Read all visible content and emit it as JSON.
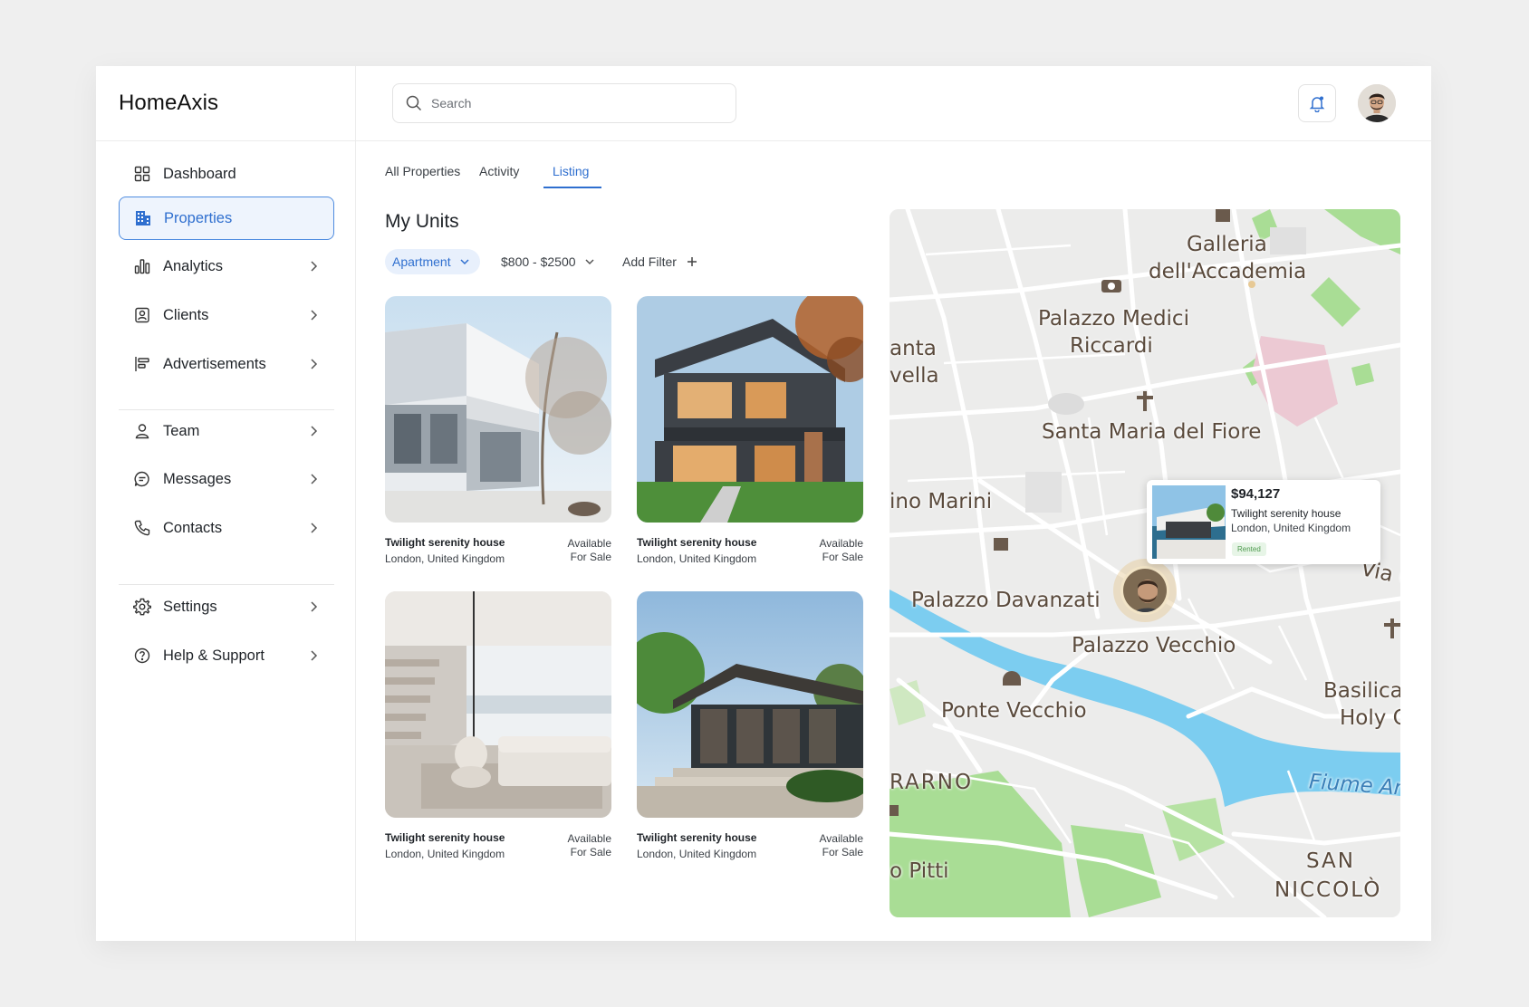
{
  "brand": "HomeAxis",
  "search": {
    "placeholder": "Search"
  },
  "sidebar": {
    "items": [
      {
        "label": "Dashboard",
        "icon": "grid-icon"
      },
      {
        "label": "Properties",
        "icon": "building-icon",
        "active": true
      },
      {
        "label": "Analytics",
        "icon": "bar-chart-icon"
      },
      {
        "label": "Clients",
        "icon": "contact-card-icon"
      },
      {
        "label": "Advertisements",
        "icon": "ads-icon"
      },
      {
        "label": "Team",
        "icon": "user-icon"
      },
      {
        "label": "Messages",
        "icon": "chat-icon"
      },
      {
        "label": "Contacts",
        "icon": "phone-icon"
      },
      {
        "label": "Settings",
        "icon": "gear-icon"
      },
      {
        "label": "Help & Support",
        "icon": "help-icon"
      }
    ]
  },
  "tabs": [
    {
      "label": "All Properties"
    },
    {
      "label": "Activity"
    },
    {
      "label": "Listing",
      "active": true
    }
  ],
  "main": {
    "title": "My Units",
    "filters": {
      "type": "Apartment",
      "price": "$800 - $2500",
      "add": "Add Filter"
    },
    "cards": [
      {
        "name": "Twilight serenity house",
        "location": "London, United Kingdom",
        "status_line1": "Available",
        "status_line2": "For Sale"
      },
      {
        "name": "Twilight serenity house",
        "location": "London, United Kingdom",
        "status_line1": "Available",
        "status_line2": "For Sale"
      },
      {
        "name": "Twilight serenity house",
        "location": "London, United Kingdom",
        "status_line1": "Available",
        "status_line2": "For Sale"
      },
      {
        "name": "Twilight serenity house",
        "location": "London, United Kingdom",
        "status_line1": "Available",
        "status_line2": "For Sale"
      }
    ]
  },
  "map": {
    "labels": {
      "galleria1": "Galleria",
      "galleria2": "dell'Accademia",
      "medici1": "Palazzo Medici",
      "medici2": "Riccardi",
      "anta": "anta",
      "vella": "vella",
      "fiore": "Santa Maria del Fiore",
      "marini": "ino Marini",
      "davanzati": "Palazzo Davanzati",
      "vecchio": "Palazzo Vecchio",
      "viac": "Via C",
      "ponte": "Ponte Vecchio",
      "basilica1": "Basilica",
      "basilica2": "Holy C",
      "rarno": "RARNO",
      "fiume": "Fiume Ar",
      "pitti": "o Pitti",
      "san": "SAN",
      "niccolo": "NICCOLÒ"
    },
    "popup": {
      "price": "$94,127",
      "name": "Twilight serenity house",
      "location": "London, United Kingdom",
      "badge": "Rented"
    }
  },
  "colors": {
    "accent": "#2f6fcf",
    "river": "#7ccdf0",
    "park": "#a9dd95",
    "badge_bg": "#e7f5e7",
    "badge_text": "#4e9a4e"
  }
}
